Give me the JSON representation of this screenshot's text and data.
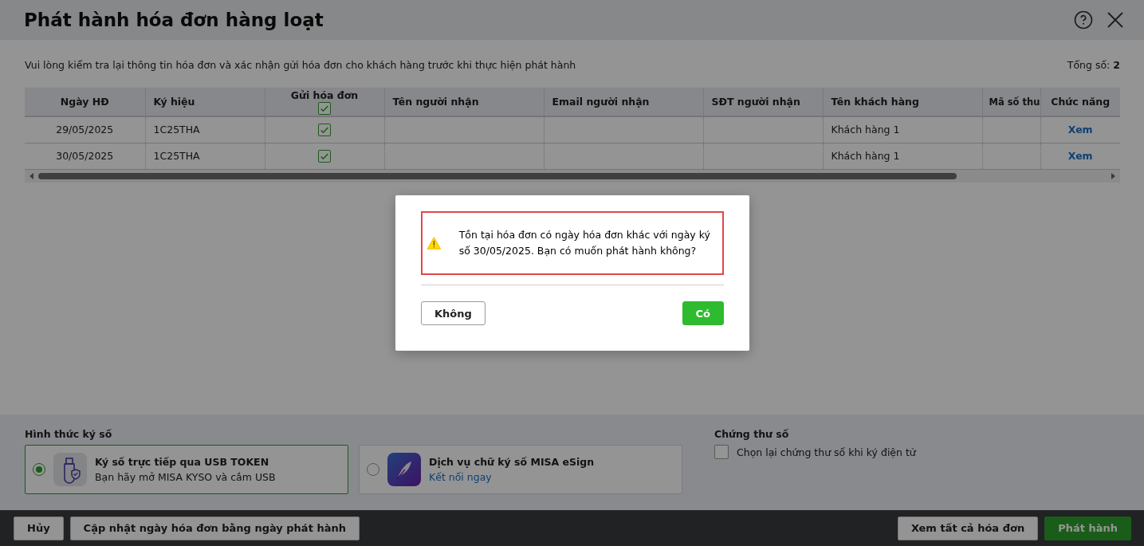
{
  "title": "Phát hành hóa đơn hàng loạt",
  "instruction": "Vui lòng kiểm tra lại thông tin hóa đơn và xác nhận gửi hóa đơn cho khách hàng trước khi thực hiện phát hành",
  "total": {
    "label": "Tổng số:",
    "value": "2"
  },
  "table": {
    "columns": [
      "Ngày HĐ",
      "Ký hiệu",
      "Gửi hóa đơn",
      "Tên người nhận",
      "Email người nhận",
      "SĐT người nhận",
      "Tên khách hàng",
      "Mã số thu",
      "Chức năng"
    ],
    "send_all_checked": true,
    "rows": [
      {
        "date": "29/05/2025",
        "symbol": "1C25THA",
        "send": true,
        "customer": "Khách hàng 1",
        "action": "Xem"
      },
      {
        "date": "30/05/2025",
        "symbol": "1C25THA",
        "send": true,
        "customer": "Khách hàng 1",
        "action": "Xem"
      }
    ]
  },
  "signing": {
    "label": "Hình thức ký số",
    "options": [
      {
        "kind": "usb",
        "title": "Ký số trực tiếp qua USB TOKEN",
        "subtitle": "Bạn hãy mở MISA KYSO và cắm USB",
        "selected": true
      },
      {
        "kind": "esign",
        "title": "Dịch vụ chữ ký số MISA eSign",
        "subtitle": "Kết nối ngay",
        "selected": false
      }
    ]
  },
  "certificate": {
    "label": "Chứng thư số",
    "option": "Chọn lại chứng thư số khi ký điện tử",
    "checked": false
  },
  "footer": {
    "left_buttons": [
      "Hủy",
      "Cập nhật ngày hóa đơn bằng ngày phát hành"
    ],
    "right_buttons": [
      {
        "label": "Xem tất cả hóa đơn",
        "kind": "secondary"
      },
      {
        "label": "Phát hành",
        "kind": "primary"
      }
    ]
  },
  "confirm": {
    "message": "Tồn tại hóa đơn có ngày hóa đơn khác với ngày ký số 30/05/2025. Bạn có muốn phát hành không?",
    "buttons": [
      {
        "label": "Không",
        "kind": "secondary"
      },
      {
        "label": "Có",
        "kind": "primary"
      }
    ]
  }
}
